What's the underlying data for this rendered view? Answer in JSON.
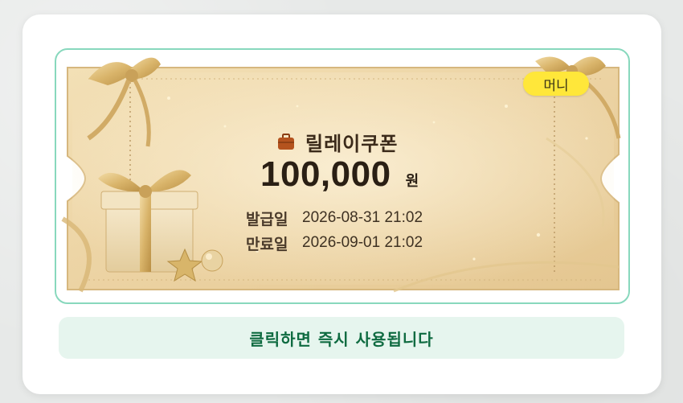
{
  "coupon": {
    "badge": "머니",
    "title": "릴레이쿠폰",
    "amount": "100,000",
    "currency": "원",
    "issued_label": "발급일",
    "issued_value": "2026-08-31 21:02",
    "expiry_label": "만료일",
    "expiry_value": "2026-09-01 21:02"
  },
  "action": {
    "label": "클릭하면 즉시 사용됩니다"
  },
  "colors": {
    "frame_border": "#88d8bd",
    "badge_bg": "#ffe73a",
    "button_bg": "#e6f5ee",
    "button_text": "#0f6b41",
    "ticket_gold": "#ecd3a3"
  }
}
